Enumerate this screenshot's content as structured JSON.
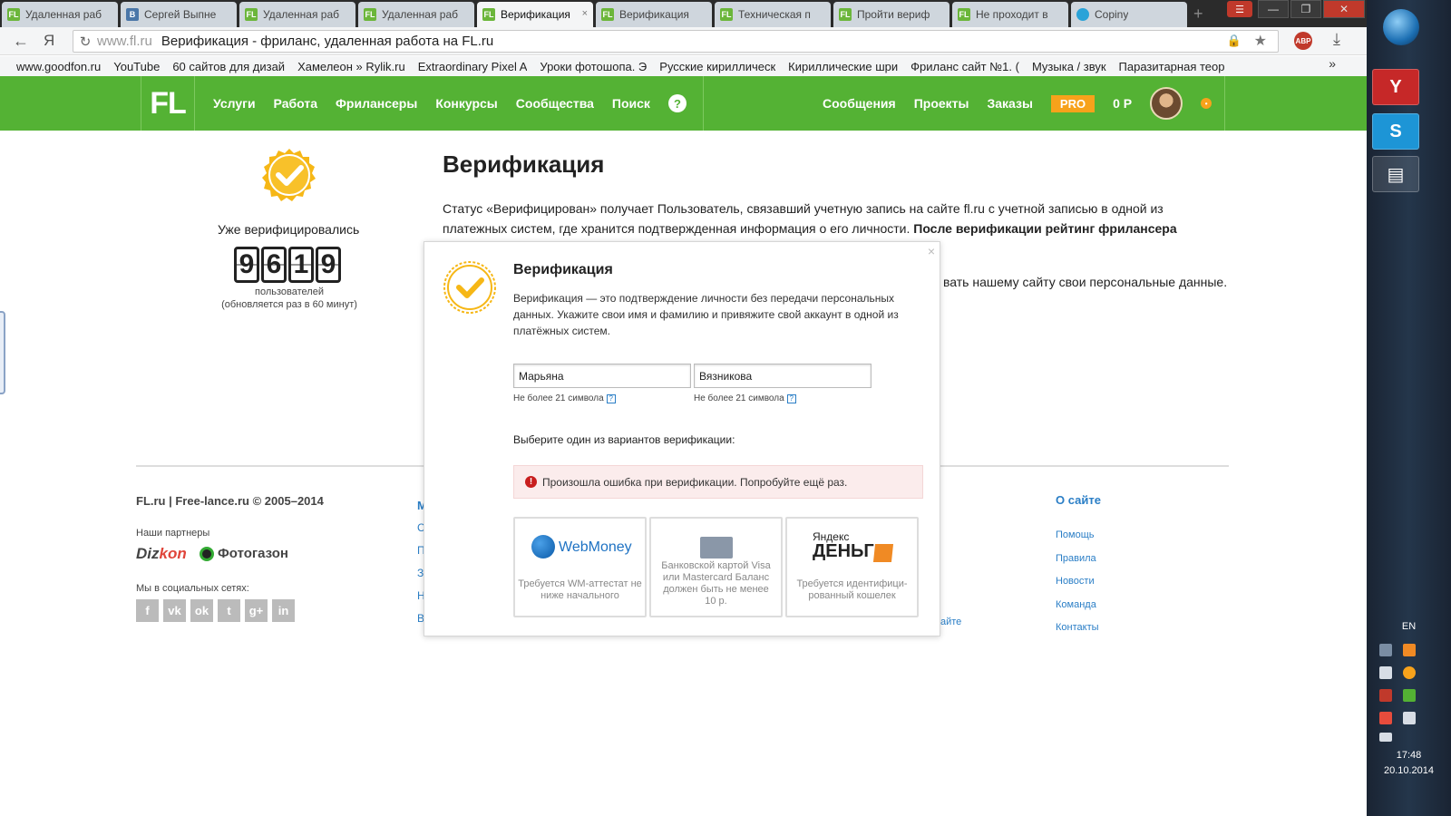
{
  "browser": {
    "tabs": [
      {
        "label": "Удаленная раб",
        "icon": "fl-favicon",
        "active": false
      },
      {
        "label": "Сергей Выпне",
        "icon": "vk-favicon",
        "active": false
      },
      {
        "label": "Удаленная раб",
        "icon": "fl-favicon",
        "active": false
      },
      {
        "label": "Удаленная раб",
        "icon": "fl-favicon",
        "active": false
      },
      {
        "label": "Верификация",
        "icon": "fl-favicon",
        "active": true
      },
      {
        "label": "Верификация",
        "icon": "fl-favicon",
        "active": false
      },
      {
        "label": "Техническая п",
        "icon": "fl-favicon",
        "active": false
      },
      {
        "label": "Пройти вериф",
        "icon": "fl-favicon",
        "active": false
      },
      {
        "label": "Не проходит в",
        "icon": "fl-favicon",
        "active": false
      },
      {
        "label": "Copiny",
        "icon": "copiny-favicon",
        "active": false
      }
    ],
    "address": {
      "url": "www.fl.ru",
      "title": "Верификация - фриланс, удаленная работа на FL.ru"
    },
    "bookmarks": [
      "www.goodfon.ru",
      "YouTube",
      "60 сайтов для дизай",
      "Хамелеон » Rylik.ru",
      "Extraordinary Pixel A",
      "Уроки фотошопа. Э",
      "Русские кириллическ",
      "Кириллические шри",
      "Фриланс сайт №1. (",
      "Музыка / звук",
      "Паразитарная теор"
    ],
    "bookmarks_more": "»"
  },
  "site": {
    "logo": "FL",
    "nav": [
      "Услуги",
      "Работа",
      "Фрилансеры",
      "Конкурсы",
      "Сообщества",
      "Поиск"
    ],
    "help_icon": "?",
    "nav_right": [
      "Сообщения",
      "Проекты",
      "Заказы"
    ],
    "pro": "PRO",
    "balance": "0 Р"
  },
  "sidebar": {
    "already_label": "Уже верифицировались",
    "counter_digits": [
      "9",
      "6",
      "1",
      "9"
    ],
    "users_label": "пользователей",
    "update_note": "(обновляется раз в 60 минут)"
  },
  "main": {
    "title": "Верификация",
    "para1": "Статус «Верифицирован» получает Пользователь, связавший учетную запись на сайте fl.ru с учетной записью в одной из платежных систем, где хранится подтвержденная информация о его личности.",
    "para1_bold": "После верификации рейтинг фрилансера",
    "para2_fragment": "вать нашему сайту свои персональные данные."
  },
  "footer": {
    "copyright": "FL.ru | Free-lance.ru © 2005–2014",
    "partners_label": "Наши партнеры",
    "partner1_a": "Diz",
    "partner1_b": "kon",
    "partner2": "Фотогазон",
    "social_label": "Мы в социальных сетях:",
    "social_icons": [
      "f",
      "vk",
      "ok",
      "tw",
      "g+",
      "in"
    ],
    "mid_col_letters": [
      "М",
      "С",
      "П",
      "З",
      "Н",
      "В"
    ],
    "about_title": "О сайте",
    "about_links": [
      "Помощь",
      "Правила",
      "Новости",
      "Команда",
      "Контакты"
    ],
    "site_link_fragment": "айте"
  },
  "modal": {
    "close": "×",
    "title": "Верификация",
    "description": "Верификация — это подтверждение личности без передачи персональных данных. Укажите свои имя и фамилию и привяжите свой аккаунт в одной из платёжных систем.",
    "first_name": "Марьяна",
    "last_name": "Вязникова",
    "hint": "Не более 21 символа",
    "hint_q": "?",
    "choose_label": "Выберите один из вариантов верификации:",
    "error_text": "Произошла ошибка при верификации. Попробуйте ещё раз.",
    "options": {
      "webmoney": {
        "name": "WebMoney",
        "note": "Требуется WM-аттестат не ниже начального"
      },
      "card": {
        "note": "Банковской картой Visa или Mastercard Баланс должен быть не менее 10 р."
      },
      "yandex": {
        "name_top": "Яндекс",
        "name_bottom": "ДЕНЬГИ",
        "note": "Требуется идентифици-рованный кошелек"
      }
    }
  },
  "taskbar": {
    "language": "EN",
    "time": "17:48",
    "date": "20.10.2014"
  },
  "colors": {
    "brand_green": "#54b234",
    "pro_orange": "#f7a21b",
    "link_blue": "#2a7ec6",
    "error_red": "#c81e1e"
  }
}
